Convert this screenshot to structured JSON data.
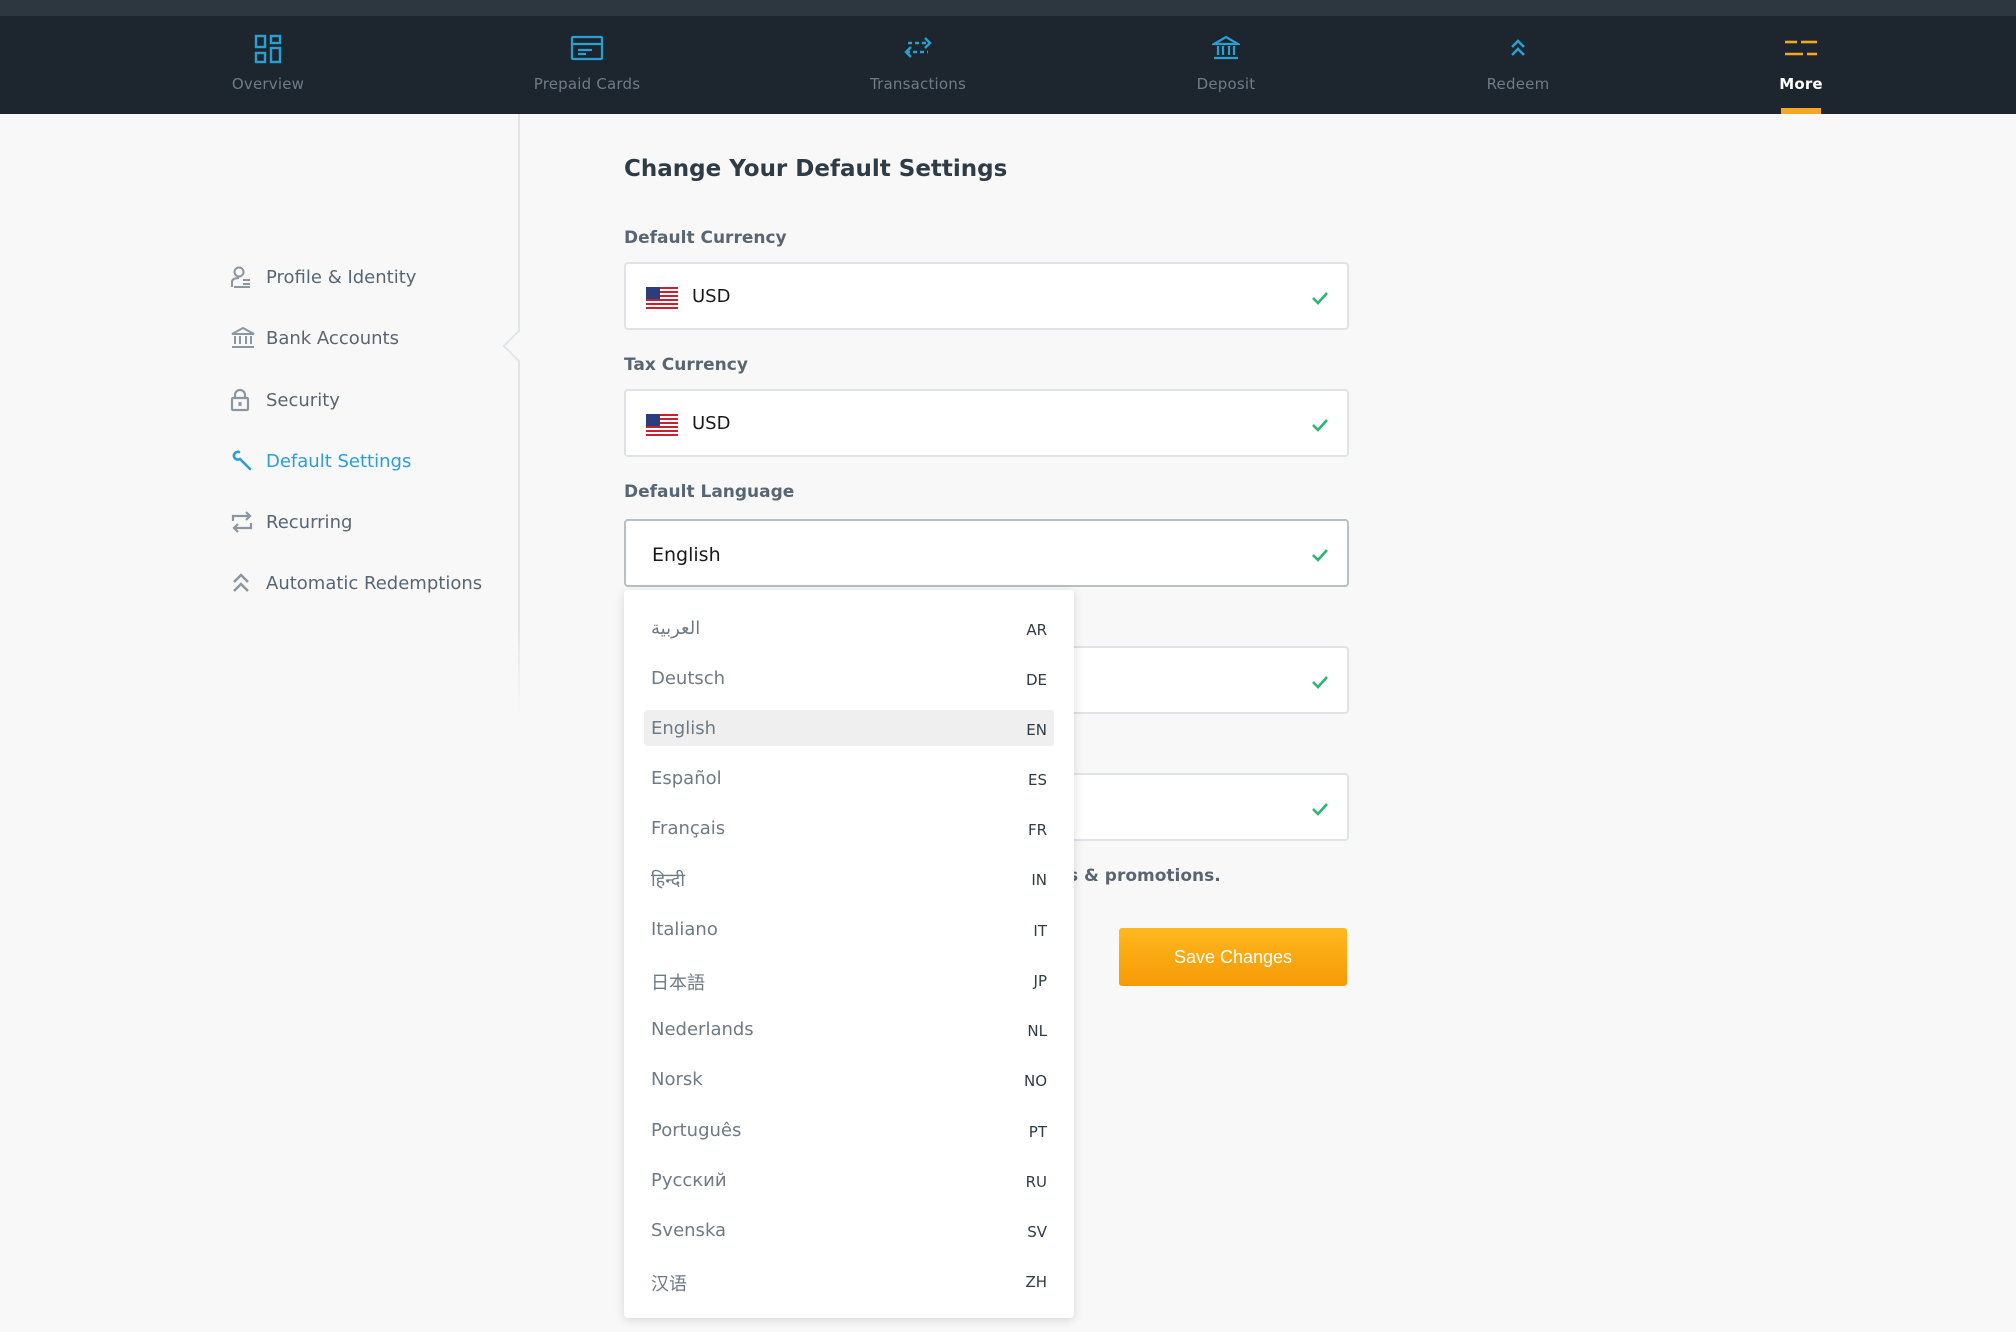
{
  "nav": {
    "items": [
      {
        "label": "Overview",
        "icon": "grid-icon"
      },
      {
        "label": "Prepaid Cards",
        "icon": "card-icon"
      },
      {
        "label": "Transactions",
        "icon": "arrows-icon"
      },
      {
        "label": "Deposit",
        "icon": "bank-icon"
      },
      {
        "label": "Redeem",
        "icon": "chevrons-up-icon"
      },
      {
        "label": "More",
        "icon": "menu-icon",
        "active": true
      }
    ],
    "icon_color": "#2a9fd1",
    "active_color": "#f5a623"
  },
  "sidebar": {
    "items": [
      {
        "label": "Profile & Identity",
        "icon": "profile-icon"
      },
      {
        "label": "Bank Accounts",
        "icon": "bank-icon"
      },
      {
        "label": "Security",
        "icon": "lock-icon"
      },
      {
        "label": "Default Settings",
        "icon": "wrench-icon",
        "active": true
      },
      {
        "label": "Recurring",
        "icon": "repeat-icon"
      },
      {
        "label": "Automatic Redemptions",
        "icon": "chevrons-up-icon"
      }
    ]
  },
  "main": {
    "title": "Change Your Default Settings",
    "default_currency": {
      "label": "Default Currency",
      "value": "USD",
      "flag": "us-flag-icon"
    },
    "tax_currency": {
      "label": "Tax Currency",
      "value": "USD",
      "flag": "us-flag-icon"
    },
    "default_language": {
      "label": "Default Language",
      "value": "English"
    },
    "promo_text": "s & promotions.",
    "save_label": "Save Changes"
  },
  "language_dropdown": {
    "selected": "EN",
    "options": [
      {
        "name": "العربية",
        "code": "AR"
      },
      {
        "name": "Deutsch",
        "code": "DE"
      },
      {
        "name": "English",
        "code": "EN"
      },
      {
        "name": "Español",
        "code": "ES"
      },
      {
        "name": "Français",
        "code": "FR"
      },
      {
        "name": "हिन्दी",
        "code": "IN"
      },
      {
        "name": "Italiano",
        "code": "IT"
      },
      {
        "name": "日本語",
        "code": "JP"
      },
      {
        "name": "Nederlands",
        "code": "NL"
      },
      {
        "name": "Norsk",
        "code": "NO"
      },
      {
        "name": "Português",
        "code": "PT"
      },
      {
        "name": "Русский",
        "code": "RU"
      },
      {
        "name": "Svenska",
        "code": "SV"
      },
      {
        "name": "汉语",
        "code": "ZH"
      }
    ]
  },
  "colors": {
    "check": "#2bb673",
    "accent": "#2a9fd1",
    "button": "#f7a30f"
  }
}
